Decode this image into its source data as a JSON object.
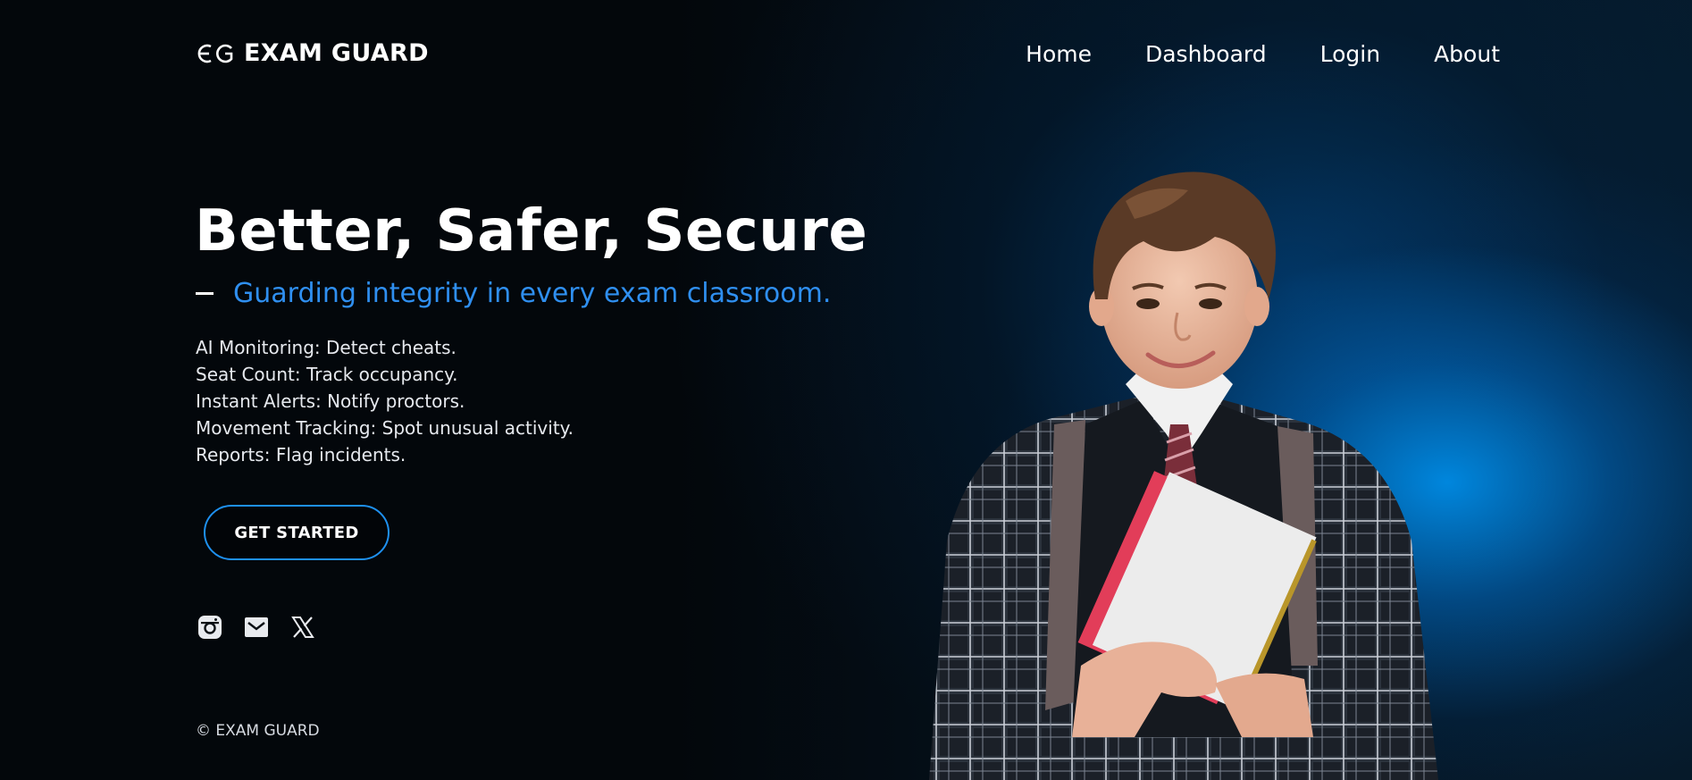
{
  "brand": {
    "name": "EXAM GUARD",
    "logo_icon": "eg-monogram-icon"
  },
  "nav": {
    "items": [
      {
        "label": "Home"
      },
      {
        "label": "Dashboard"
      },
      {
        "label": "Login"
      },
      {
        "label": "About"
      }
    ]
  },
  "hero": {
    "title": "Better, Safer, Secure",
    "tagline": "Guarding integrity in every exam classroom.",
    "features": [
      "AI Monitoring:  Detect cheats.",
      "Seat Count:  Track occupancy.",
      "Instant Alerts:  Notify proctors.",
      "Movement Tracking:  Spot unusual activity.",
      "Reports:  Flag incidents."
    ],
    "cta_label": "GET STARTED"
  },
  "socials": [
    {
      "icon": "instagram-icon"
    },
    {
      "icon": "mail-icon"
    },
    {
      "icon": "x-twitter-icon"
    }
  ],
  "footer": {
    "copyright": "© EXAM GUARD"
  },
  "colors": {
    "accent": "#2f8ff0",
    "button_border": "#1e90ef",
    "background": "#03070b",
    "glow": "#008ce6"
  }
}
